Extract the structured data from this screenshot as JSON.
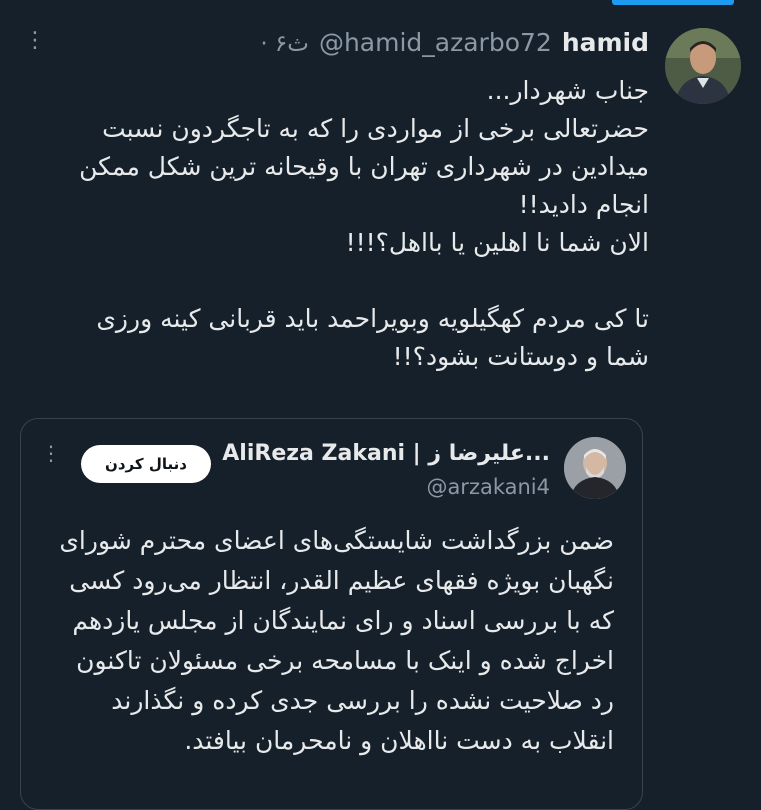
{
  "tweet": {
    "name": "hamid",
    "handle": "@hamid_azarbo72",
    "time": "· ۶ث",
    "more_icon": "more-dots-icon",
    "body_lines": [
      "جناب شهردار...",
      "حضرتعالی برخی از مواردی را که به تاجگردون نسبت",
      "میدادین در شهرداری تهران با وقیحانه ترین شکل ممکن",
      "انجام دادید!!",
      "الان شما نا اهلین یا بااهل؟!!!",
      "",
      "تا کی مردم کهگیلویه وبویراحمد باید قربانی کینه ورزی",
      "شما و دوستانت بشود؟!!"
    ]
  },
  "quote": {
    "name": "AliReza Zakani | علیرضا ز...",
    "handle": "@arzakani4",
    "follow_label": "دنبال کردن",
    "more_icon": "more-dots-icon",
    "body_lines": [
      "ضمن بزرگداشت شایستگی‌های اعضای محترم شورای",
      "نگهبان بویژه فقهای عظیم القدر، انتظار می‌رود کسی",
      "که با بررسی اسناد و رای نمایندگان از مجلس یازدهم",
      "اخراج شده و اینک با مسامحه برخی مسئولان تاکنون",
      "رد صلاحیت نشده را بررسی جدی کرده و نگذارند",
      "انقلاب به دست نااهلان و نامحرمان بیافتد."
    ]
  },
  "colors": {
    "background": "#15202b",
    "text": "#e7e9ea",
    "muted": "#8b98a5",
    "accent": "#1d9bf0",
    "border": "#38444d"
  }
}
